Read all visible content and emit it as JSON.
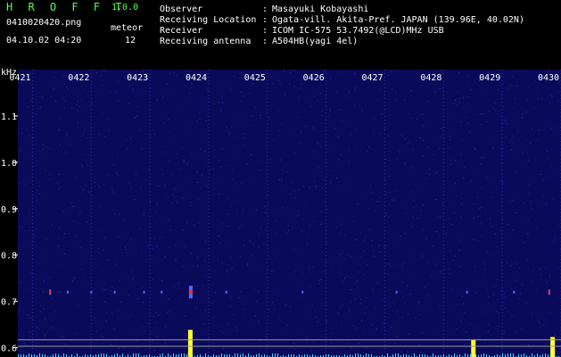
{
  "header": {
    "app_title": "H R O F F T",
    "app_version": "1.0.0",
    "filename": "0410020420.png",
    "datetime": "04.10.02 04:20",
    "meteor_label": "meteor",
    "meteor_count": "12",
    "info": [
      {
        "key": "Observer",
        "value": "Masayuki Kobayashi"
      },
      {
        "key": "Receiving Location",
        "value": "Ogata-vill. Akita-Pref. JAPAN (139.96E, 40.02N)"
      },
      {
        "key": "Receiver",
        "value": "ICOM IC-575 53.7492(@LCD)MHz USB"
      },
      {
        "key": "Receiving antenna",
        "value": "A504HB(yagi 4el)"
      }
    ]
  },
  "colors": {
    "background": "#000000",
    "spectrogram_bg": "#0a0a5a",
    "noise": "#3a3ac8",
    "signal_low": "#4a6cff",
    "signal_high": "#ff2a2a",
    "title_green": "#52ff52",
    "level_cyan": "#4ad8ff",
    "level_peak": "#ffff33",
    "ref_line": "#9a9a9a"
  },
  "chart_data": {
    "type": "heatmap",
    "ylabel": "kHz",
    "x_tick_labels": [
      "0421",
      "0422",
      "0423",
      "0424",
      "0425",
      "0426",
      "0427",
      "0428",
      "0429",
      "0430"
    ],
    "y_tick_labels": [
      "1.1",
      "1.0",
      "0.9",
      "0.8",
      "0.7",
      "0.6"
    ],
    "y_ticks": [
      1.1,
      1.0,
      0.9,
      0.8,
      0.7,
      0.6
    ],
    "xlim": [
      420.75,
      430.0
    ],
    "ylim": [
      0.58,
      1.2
    ],
    "signal_band_khz": 0.72,
    "echoes": [
      {
        "time": 421.3,
        "strength": "medium"
      },
      {
        "time": 421.6,
        "strength": "weak"
      },
      {
        "time": 422.0,
        "strength": "weak"
      },
      {
        "time": 422.4,
        "strength": "weak"
      },
      {
        "time": 422.9,
        "strength": "weak"
      },
      {
        "time": 423.2,
        "strength": "weak"
      },
      {
        "time": 423.68,
        "strength": "strong"
      },
      {
        "time": 424.3,
        "strength": "weak"
      },
      {
        "time": 425.6,
        "strength": "weak"
      },
      {
        "time": 427.2,
        "strength": "weak"
      },
      {
        "time": 428.4,
        "strength": "weak"
      },
      {
        "time": 429.2,
        "strength": "weak"
      },
      {
        "time": 429.8,
        "strength": "medium"
      }
    ],
    "level_peaks": [
      {
        "time": 423.68,
        "level": 0.95
      },
      {
        "time": 428.5,
        "level": 0.6
      },
      {
        "time": 429.85,
        "level": 0.7
      }
    ],
    "reference_lines_khz": [
      0.617,
      0.603
    ]
  }
}
